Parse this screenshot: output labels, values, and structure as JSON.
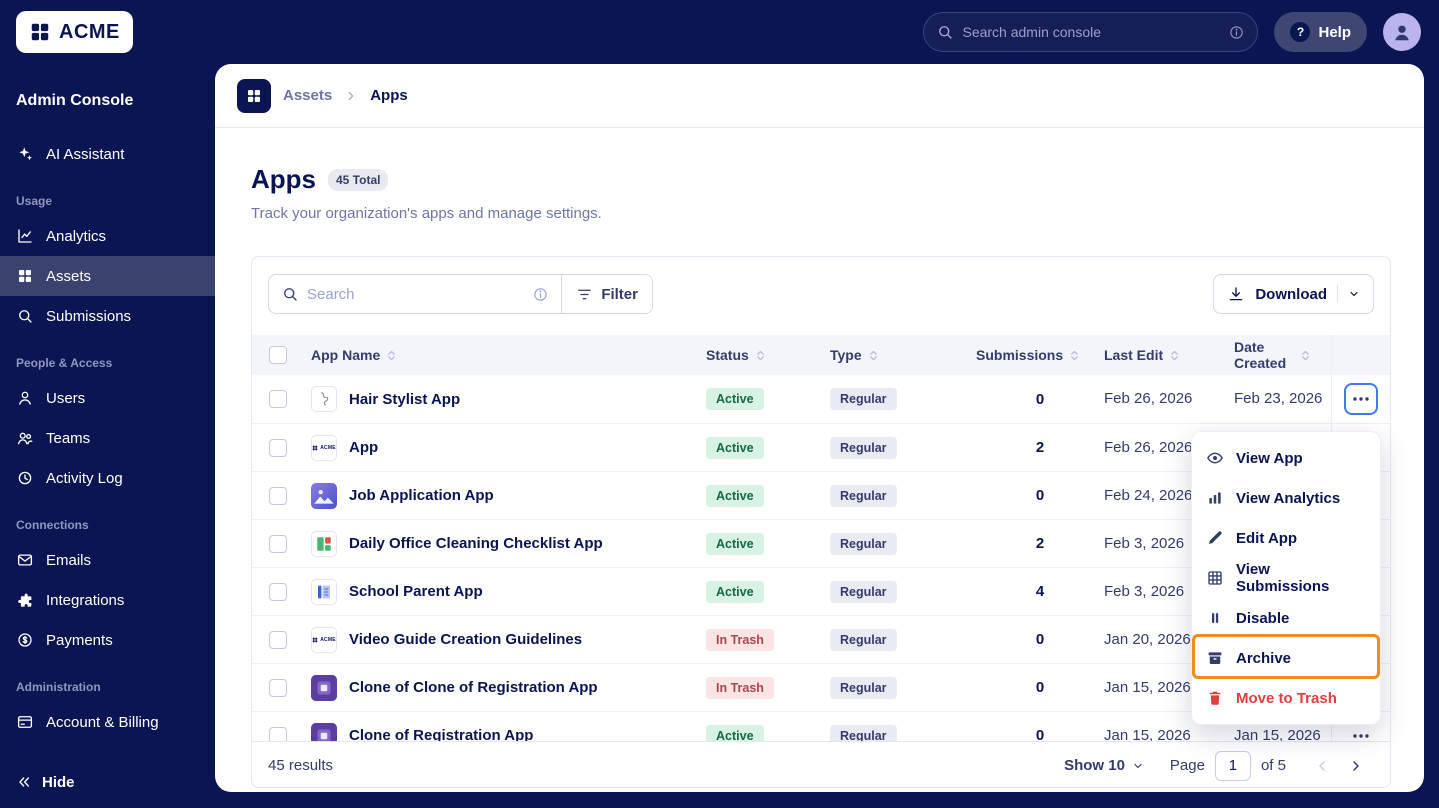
{
  "topbar": {
    "logo_text": "ACME",
    "search_placeholder": "Search admin console",
    "help_label": "Help"
  },
  "sidebar": {
    "title": "Admin Console",
    "assistant_label": "AI Assistant",
    "groups": [
      {
        "label": "Usage",
        "items": [
          {
            "label": "Analytics"
          },
          {
            "label": "Assets"
          },
          {
            "label": "Submissions"
          }
        ]
      },
      {
        "label": "People & Access",
        "items": [
          {
            "label": "Users"
          },
          {
            "label": "Teams"
          },
          {
            "label": "Activity Log"
          }
        ]
      },
      {
        "label": "Connections",
        "items": [
          {
            "label": "Emails"
          },
          {
            "label": "Integrations"
          },
          {
            "label": "Payments"
          }
        ]
      },
      {
        "label": "Administration",
        "items": [
          {
            "label": "Account & Billing"
          }
        ]
      }
    ],
    "hide_label": "Hide"
  },
  "breadcrumb": {
    "parent": "Assets",
    "current": "Apps"
  },
  "page": {
    "title": "Apps",
    "badge": "45 Total",
    "subtitle": "Track your organization's apps and manage settings."
  },
  "toolbar": {
    "search_placeholder": "Search",
    "filter_label": "Filter",
    "download_label": "Download"
  },
  "table": {
    "columns": {
      "name": "App Name",
      "status": "Status",
      "type": "Type",
      "submissions": "Submissions",
      "last_edit": "Last Edit",
      "date_created": "Date Created"
    },
    "rows": [
      {
        "name": "Hair Stylist App",
        "status": "Active",
        "type": "Regular",
        "submissions": "0",
        "last_edit": "Feb 26, 2026",
        "date_created": "Feb 23, 2026"
      },
      {
        "name": "App",
        "status": "Active",
        "type": "Regular",
        "submissions": "2",
        "last_edit": "Feb 26, 2026",
        "date_created": ""
      },
      {
        "name": "Job Application App",
        "status": "Active",
        "type": "Regular",
        "submissions": "0",
        "last_edit": "Feb 24, 2026",
        "date_created": ""
      },
      {
        "name": "Daily Office Cleaning Checklist App",
        "status": "Active",
        "type": "Regular",
        "submissions": "2",
        "last_edit": "Feb 3, 2026",
        "date_created": ""
      },
      {
        "name": "School Parent App",
        "status": "Active",
        "type": "Regular",
        "submissions": "4",
        "last_edit": "Feb 3, 2026",
        "date_created": ""
      },
      {
        "name": "Video Guide Creation Guidelines",
        "status": "In Trash",
        "type": "Regular",
        "submissions": "0",
        "last_edit": "Jan 20, 2026",
        "date_created": ""
      },
      {
        "name": "Clone of Clone of Registration App",
        "status": "In Trash",
        "type": "Regular",
        "submissions": "0",
        "last_edit": "Jan 15, 2026",
        "date_created": ""
      },
      {
        "name": "Clone of Registration App",
        "status": "Active",
        "type": "Regular",
        "submissions": "0",
        "last_edit": "Jan 15, 2026",
        "date_created": "Jan 15, 2026"
      }
    ],
    "footer": {
      "results": "45 results",
      "show": "Show 10",
      "page_label": "Page",
      "page_value": "1",
      "of": "of 5"
    }
  },
  "menu": {
    "items": [
      {
        "label": "View App"
      },
      {
        "label": "View Analytics"
      },
      {
        "label": "Edit App"
      },
      {
        "label": "View Submissions"
      },
      {
        "label": "Disable"
      },
      {
        "label": "Archive"
      },
      {
        "label": "Move to Trash"
      }
    ]
  },
  "colors": {
    "navy": "#0a1551",
    "accent_blue": "#4277f5",
    "annotation_orange": "#ef8b1f",
    "danger_red": "#e03e3e",
    "active_green_bg": "#d8f2e4",
    "trash_red_bg": "#fae4e4"
  }
}
